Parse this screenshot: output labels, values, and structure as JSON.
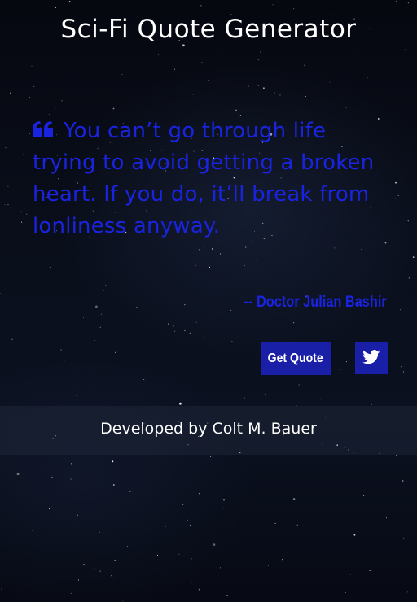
{
  "header": {
    "title": "Sci-Fi Quote Generator"
  },
  "quote": {
    "text": "You can’t go through life trying to avoid getting a broken heart. If you do, it’ll break from lonliness anyway.",
    "author": "-- Doctor Julian Bashir",
    "icon": "quote-left-icon",
    "color": "#1a24e0"
  },
  "actions": {
    "get_quote_label": "Get Quote",
    "tweet_icon": "twitter-icon",
    "button_color": "#1a1fa8"
  },
  "footer": {
    "credit": "Developed by Colt M. Bauer"
  }
}
